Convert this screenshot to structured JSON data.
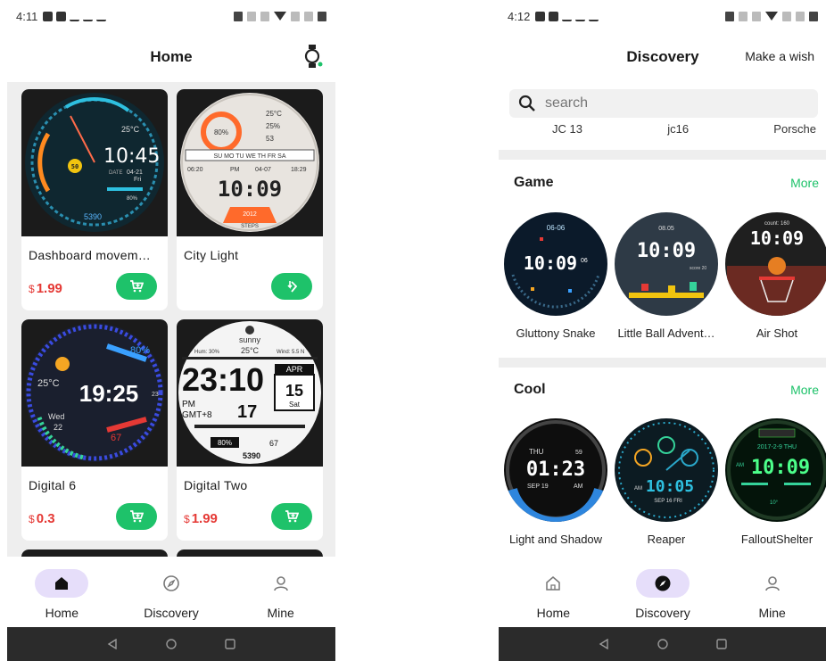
{
  "left_screen": {
    "status_bar": {
      "time": "4:11"
    },
    "header": {
      "title": "Home"
    },
    "products": [
      {
        "name": "Dashboard movem…",
        "currency": "$",
        "price": "1.99",
        "action": "cart",
        "face": {
          "time": "10:45",
          "temp": "25°C",
          "date": "04-21",
          "day": "Fri",
          "steps": "5390",
          "date_label": "DATE",
          "power": "80%",
          "dial_num": "50"
        },
        "colors": {
          "bg": "#0f2730",
          "ring": "#2a8fb0"
        }
      },
      {
        "name": "City Light",
        "currency": "",
        "price": "",
        "action": "install",
        "face": {
          "time": "10:09",
          "pct": "80%",
          "temp": "25°C",
          "humidity": "25%",
          "wind": "53",
          "days": "SU MO TU WE TH FR SA",
          "year": "2012",
          "steps": "STEPS",
          "date": "04-07",
          "pm": "PM",
          "left_time": "06:20",
          "right_time": "18:29"
        },
        "colors": {
          "bg": "#e8e4df",
          "accent": "#ff6a2b"
        }
      },
      {
        "name": "Digital 6",
        "currency": "$",
        "price": "0.3",
        "action": "cart",
        "face": {
          "time": "19:25",
          "temp": "25°C",
          "sec": "23",
          "day": "Wed",
          "date": "22",
          "pct": "80%",
          "num": "67"
        },
        "colors": {
          "bg": "#1a1f2e",
          "accent": "#3aa0ff"
        }
      },
      {
        "name": "Digital Two",
        "currency": "$",
        "price": "1.99",
        "action": "cart",
        "face": {
          "weather": "sunny",
          "hum": "Hum: 30%",
          "temp": "25°C",
          "wind": "Wind: 5.5 N",
          "time": "23:10",
          "month": "APR",
          "day_num": "15",
          "pm": "PM",
          "gmt": "GMT+8",
          "date": "17",
          "weekday": "Sat",
          "battery": "80%",
          "heart": "67",
          "steps": "5390"
        },
        "colors": {
          "bg": "#f4f4f4"
        }
      }
    ],
    "bottom_nav": [
      {
        "label": "Home",
        "icon": "home-icon",
        "active": true
      },
      {
        "label": "Discovery",
        "icon": "compass-icon",
        "active": false
      },
      {
        "label": "Mine",
        "icon": "person-icon",
        "active": false
      }
    ]
  },
  "right_screen": {
    "status_bar": {
      "time": "4:12"
    },
    "header": {
      "title": "Discovery",
      "action": "Make a wish"
    },
    "search": {
      "placeholder": "search"
    },
    "cut_labels": [
      "JC 13",
      "jc16",
      "Porsche"
    ],
    "sections": [
      {
        "title": "Game",
        "more": "More",
        "items": [
          {
            "name": "Gluttony Snake",
            "face": {
              "top": "06-06",
              "time": "10:09",
              "sec": "06"
            },
            "bg": "#0b1a2a"
          },
          {
            "name": "Little Ball Advent…",
            "face": {
              "top": "08.05",
              "time": "10:09",
              "score": "score 20"
            },
            "bg": "#2e3a46"
          },
          {
            "name": "Air Shot",
            "face": {
              "top": "count: 160",
              "time": "10:09"
            },
            "bg": "#1f1f1f"
          }
        ]
      },
      {
        "title": "Cool",
        "more": "More",
        "items": [
          {
            "name": "Light and Shadow",
            "face": {
              "day": "THU",
              "time": "01:23",
              "date": "SEP 19",
              "ampm": "AM",
              "sec": "59"
            },
            "bg": "#0e0e0e"
          },
          {
            "name": "Reaper",
            "face": {
              "time": "10:05",
              "date": "SEP 16 FRI",
              "ampm": "AM"
            },
            "bg": "#0c1b22"
          },
          {
            "name": "FalloutShelter",
            "face": {
              "date": "2017-2-9 THU",
              "time": "10:09",
              "ampm": "AM",
              "temp": "10°"
            },
            "bg": "#04140a"
          }
        ]
      }
    ],
    "bottom_nav": [
      {
        "label": "Home",
        "icon": "home-icon",
        "active": false
      },
      {
        "label": "Discovery",
        "icon": "compass-icon",
        "active": true
      },
      {
        "label": "Mine",
        "icon": "person-icon",
        "active": false
      }
    ]
  },
  "colors": {
    "accent_green": "#1ec26a",
    "price_red": "#e53935",
    "nav_pill": "#e6defa",
    "content_bg": "#eeeeee"
  }
}
